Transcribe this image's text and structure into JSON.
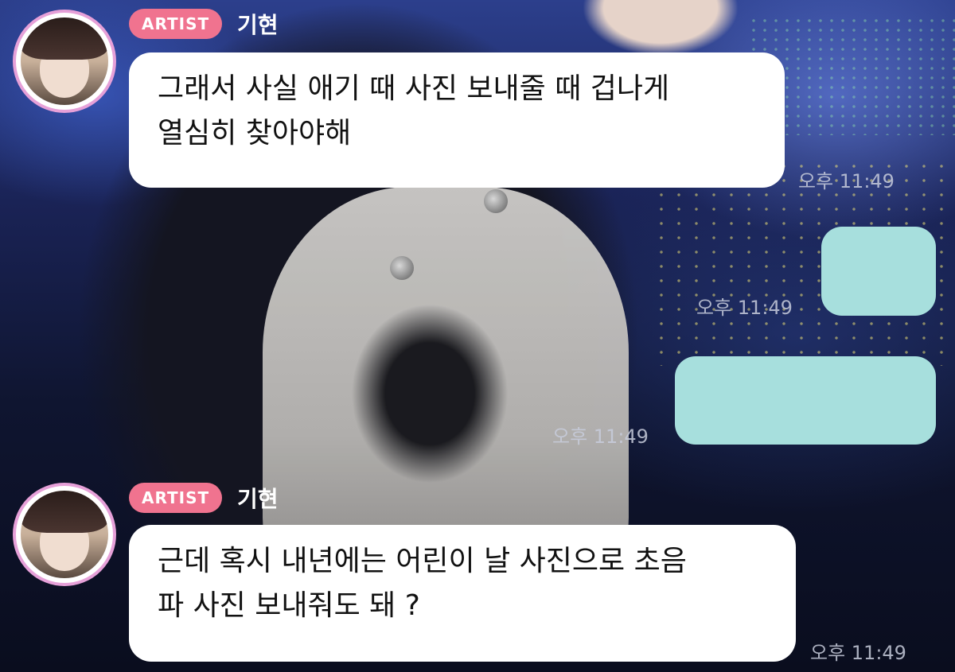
{
  "messages": [
    {
      "sender": "기현",
      "badge": "ARTIST",
      "lines": [
        "그래서 사실 애기 때 사진 보내줄 때 겁나게",
        "열심히 찾아야해"
      ],
      "time": "오후 11:49"
    },
    {
      "mine": true,
      "text": "",
      "time": "오후 11:49"
    },
    {
      "mine": true,
      "text": "",
      "time": "오후 11:49"
    },
    {
      "sender": "기현",
      "badge": "ARTIST",
      "lines": [
        "근데 혹시 내년에는 어린이 날 사진으로 초음",
        "파 사진 보내줘도 돼 ?"
      ],
      "time": "오후 11:49"
    }
  ],
  "colors": {
    "badge": "#f0738f",
    "my_bubble": "#a7dfdd",
    "avatar_ring": "#e6a0d8"
  }
}
